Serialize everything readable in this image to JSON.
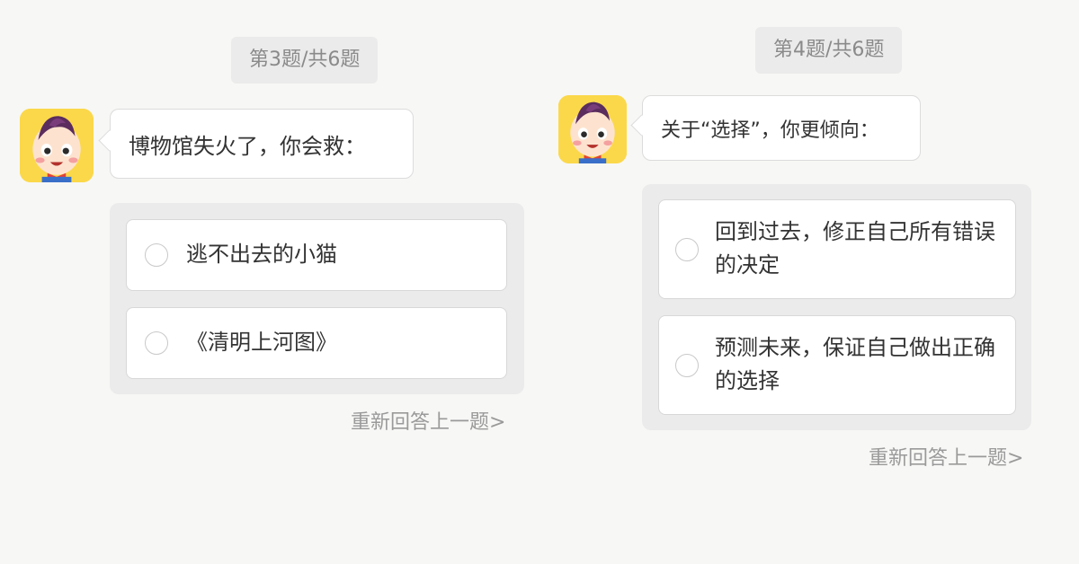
{
  "questions": [
    {
      "counter": "第3题/共6题",
      "prompt": "博物馆失火了，你会救：",
      "options": [
        {
          "label": "逃不出去的小猫"
        },
        {
          "label": "《清明上河图》"
        }
      ],
      "redo_label": "重新回答上一题>"
    },
    {
      "counter": "第4题/共6题",
      "prompt": "关于“选择”，你更倾向：",
      "options": [
        {
          "label": "回到过去，修正自己所有错误的决定"
        },
        {
          "label": "预测未来，保证自己做出正确的选择"
        }
      ],
      "redo_label": "重新回答上一题>"
    }
  ],
  "avatar": {
    "icon": "cartoon-boy-avatar-icon",
    "background_color": "#fbd84a"
  }
}
